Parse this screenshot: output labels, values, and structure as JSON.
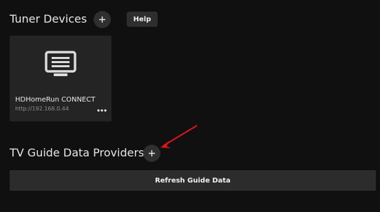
{
  "tuner_section": {
    "title": "Tuner Devices",
    "add_icon": "plus-icon",
    "help_label": "Help"
  },
  "device": {
    "name": "HDHomeRun CONNECT",
    "url": "http://192.168.0.44",
    "icon": "tv-screen-icon",
    "more_icon": "ellipsis-icon"
  },
  "guide_section": {
    "title": "TV Guide Data Providers",
    "add_icon": "plus-icon",
    "refresh_label": "Refresh Guide Data"
  },
  "colors": {
    "background": "#101010",
    "card": "#242424",
    "button": "#2c2c2c",
    "annotation": "#e0141b"
  }
}
